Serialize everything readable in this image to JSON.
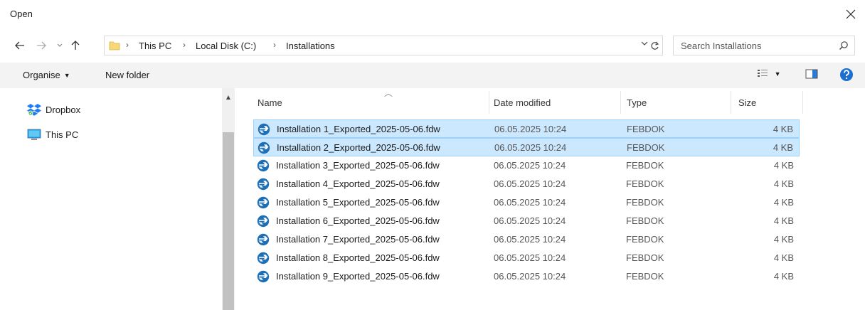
{
  "window": {
    "title": "Open",
    "close_glyph": "✕"
  },
  "nav": {
    "back_icon": "back-arrow-icon",
    "forward_icon": "forward-arrow-icon",
    "recent_icon": "chevron-down-icon",
    "up_icon": "up-arrow-icon",
    "breadcrumbs": [
      "This PC",
      "Local Disk (C:)",
      "Installations"
    ],
    "separator": "›",
    "search_placeholder": "Search Installations"
  },
  "toolbar": {
    "organise_label": "Organise",
    "new_folder_label": "New folder"
  },
  "sidebar": {
    "items": [
      {
        "label": "Dropbox",
        "icon": "dropbox-icon"
      },
      {
        "label": "This PC",
        "icon": "computer-icon"
      }
    ]
  },
  "columns": {
    "name": "Name",
    "date": "Date modified",
    "type": "Type",
    "size": "Size"
  },
  "files": [
    {
      "name": "Installation 1_Exported_2025-05-06.fdw",
      "date": "06.05.2025 10:24",
      "type": "FEBDOK",
      "size": "4 KB",
      "selected": true
    },
    {
      "name": "Installation 2_Exported_2025-05-06.fdw",
      "date": "06.05.2025 10:24",
      "type": "FEBDOK",
      "size": "4 KB",
      "selected": true
    },
    {
      "name": "Installation 3_Exported_2025-05-06.fdw",
      "date": "06.05.2025 10:24",
      "type": "FEBDOK",
      "size": "4 KB",
      "selected": false
    },
    {
      "name": "Installation 4_Exported_2025-05-06.fdw",
      "date": "06.05.2025 10:24",
      "type": "FEBDOK",
      "size": "4 KB",
      "selected": false
    },
    {
      "name": "Installation 5_Exported_2025-05-06.fdw",
      "date": "06.05.2025 10:24",
      "type": "FEBDOK",
      "size": "4 KB",
      "selected": false
    },
    {
      "name": "Installation 6_Exported_2025-05-06.fdw",
      "date": "06.05.2025 10:24",
      "type": "FEBDOK",
      "size": "4 KB",
      "selected": false
    },
    {
      "name": "Installation 7_Exported_2025-05-06.fdw",
      "date": "06.05.2025 10:24",
      "type": "FEBDOK",
      "size": "4 KB",
      "selected": false
    },
    {
      "name": "Installation 8_Exported_2025-05-06.fdw",
      "date": "06.05.2025 10:24",
      "type": "FEBDOK",
      "size": "4 KB",
      "selected": false
    },
    {
      "name": "Installation 9_Exported_2025-05-06.fdw",
      "date": "06.05.2025 10:24",
      "type": "FEBDOK",
      "size": "4 KB",
      "selected": false
    }
  ],
  "colors": {
    "selection_bg": "#cce8ff",
    "selection_border": "#99d1ff",
    "help_blue": "#1a6fd1",
    "folder_yellow": "#f8d775"
  }
}
